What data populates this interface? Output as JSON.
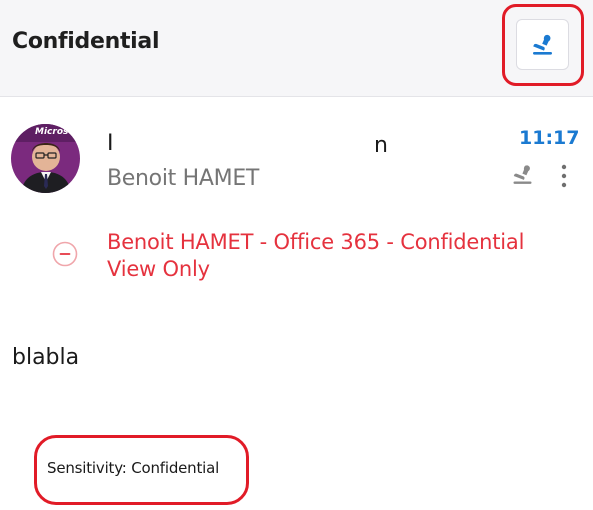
{
  "header": {
    "title": "Confidential",
    "stamp_icon": "stamp-icon"
  },
  "message": {
    "avatar_text": "Microsoft",
    "subject_start": "I",
    "subject_end": "n",
    "sender": "Benoit HAMET",
    "time": "11:17",
    "time_color": "#1b7ad1",
    "stamp_icon": "stamp-icon",
    "more_icon": "more-vertical-icon"
  },
  "protection": {
    "icon": "minus-circle-icon",
    "label": "Benoit HAMET - Office 365 - Confidential View Only",
    "color": "#e5323e"
  },
  "body": {
    "text": "blabla",
    "sensitivity": "Sensitivity: Confidential"
  },
  "annotation_color": "#e11b27"
}
